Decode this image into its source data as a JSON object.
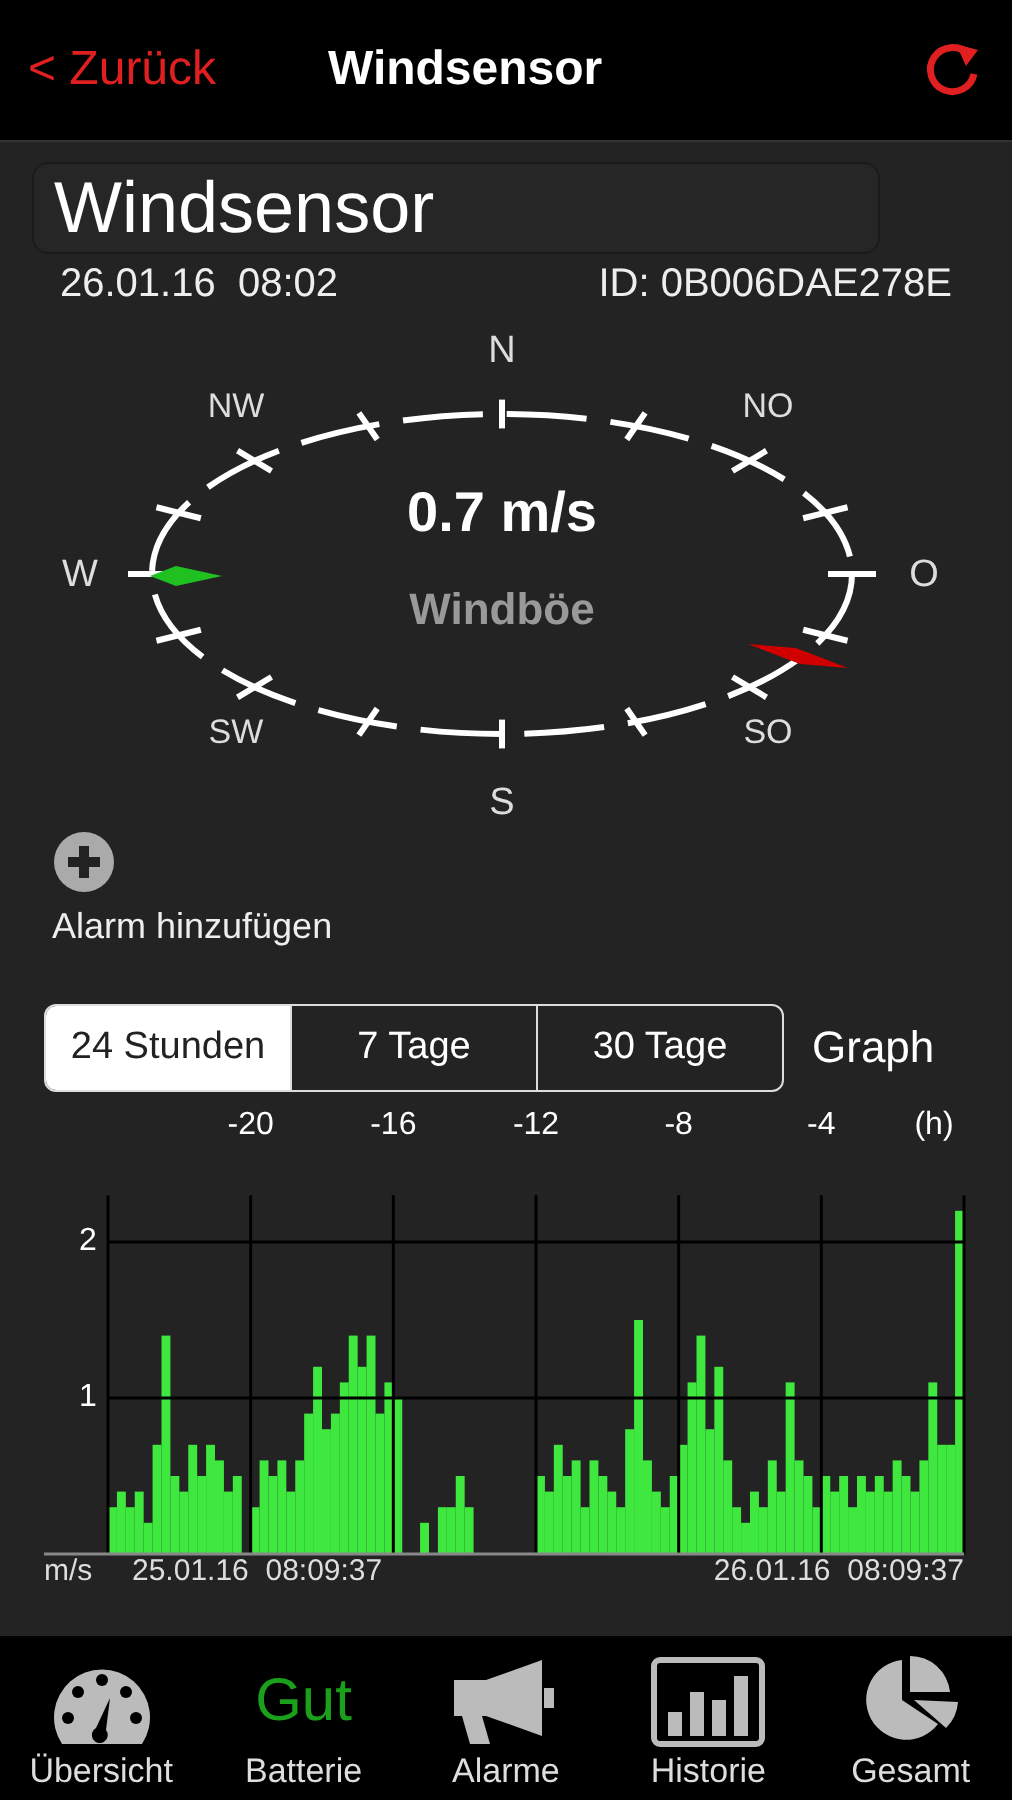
{
  "nav": {
    "back": "< Zurück",
    "title": "Windsensor"
  },
  "sensor": {
    "name": "Windsensor",
    "date": "26.01.16",
    "time": "08:02",
    "id": "ID: 0B006DAE278E"
  },
  "compass": {
    "directions": [
      "N",
      "NO",
      "O",
      "SO",
      "S",
      "SW",
      "W",
      "NW"
    ],
    "speed": "0.7 m/s",
    "caption": "Windböe"
  },
  "alarm": {
    "label": "Alarm hinzufügen"
  },
  "range_tabs": [
    {
      "label": "24 Stunden",
      "selected": true
    },
    {
      "label": "7 Tage",
      "selected": false
    },
    {
      "label": "30 Tage",
      "selected": false
    }
  ],
  "graph_label": "Graph",
  "hour_labels": [
    "-20",
    "-16",
    "-12",
    "-8",
    "-4"
  ],
  "chart_data": {
    "type": "bar",
    "xlabel": "(h)",
    "ylabel": "m/s",
    "ylim": [
      0,
      2.3
    ],
    "yticks": [
      1,
      2
    ],
    "series": [
      {
        "color": "#3ee83e",
        "values": [
          0.3,
          0.4,
          0.3,
          0.4,
          0.2,
          0.7,
          1.4,
          0.5,
          0.4,
          0.7,
          0.5,
          0.7,
          0.6,
          0.4,
          0.5,
          null,
          0.3,
          0.6,
          0.5,
          0.6,
          0.4,
          0.6,
          0.9,
          1.2,
          0.8,
          0.9,
          1.1,
          1.4,
          1.2,
          1.4,
          0.9,
          1.1,
          1.0,
          null,
          null,
          0.2,
          null,
          0.3,
          0.3,
          0.5,
          0.3,
          null,
          null,
          null,
          null,
          null,
          null,
          null,
          0.5,
          0.4,
          0.7,
          0.5,
          0.6,
          0.3,
          0.6,
          0.5,
          0.4,
          0.3,
          0.8,
          1.5,
          0.6,
          0.4,
          0.3,
          0.5,
          0.7,
          1.1,
          1.4,
          0.8,
          1.2,
          0.6,
          0.3,
          0.2,
          0.4,
          0.3,
          0.6,
          0.4,
          1.1,
          0.6,
          0.5,
          0.3,
          0.5,
          0.4,
          0.5,
          0.3,
          0.5,
          0.4,
          0.5,
          0.4,
          0.6,
          0.5,
          0.4,
          0.6,
          1.1,
          0.7,
          0.7,
          2.2
        ]
      }
    ],
    "annotations": [
      "25.01.16  08:09:37",
      "26.01.16  08:09:37"
    ]
  },
  "tab_bar": [
    {
      "kind": "icon",
      "label": "Übersicht"
    },
    {
      "kind": "status",
      "value": "Gut",
      "label": "Batterie"
    },
    {
      "kind": "icon",
      "label": "Alarme"
    },
    {
      "kind": "icon",
      "label": "Historie"
    },
    {
      "kind": "icon",
      "label": "Gesamt"
    }
  ]
}
